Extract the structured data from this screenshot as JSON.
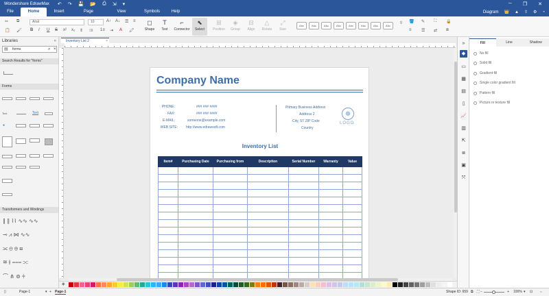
{
  "window": {
    "title": "Wondershare EdrawMax",
    "quick_access": [
      "↶",
      "↷",
      "💾",
      "📂",
      "⎙",
      "⇲",
      "▾"
    ],
    "controls": [
      "─",
      "❐",
      "✕"
    ]
  },
  "menu": {
    "tabs": [
      "File",
      "Home",
      "Insert",
      "Page Layout",
      "View",
      "Symbols",
      "Help"
    ],
    "active": "Home",
    "right_items": [
      "Diagram",
      "👑",
      "▲",
      "⇧",
      "⚙",
      "◔"
    ]
  },
  "ribbon": {
    "font_name": "Arial",
    "font_size": "10",
    "tools": {
      "shape": "Shape",
      "text": "Text",
      "connector": "Connector",
      "select": "Select",
      "position": "Position",
      "group": "Group",
      "align": "Align",
      "rotate": "Rotate",
      "size": "Size"
    },
    "style_boxes": [
      "Abc",
      "Abc",
      "Abc",
      "Abc",
      "Abc",
      "Abc",
      "Abc",
      "Abc"
    ]
  },
  "library": {
    "title": "Libraries",
    "search_value": "forms",
    "results_header": "Search Results for \"forms\"",
    "forms_header": "Forms",
    "transformers_header": "Transformers and Windings",
    "form_labels": [
      "Text",
      "Text",
      "Text"
    ]
  },
  "document": {
    "tab_name": "Inventory List 2",
    "company_name": "Company Name",
    "contact": {
      "phone_label": "PHONE:",
      "phone_value": "### ### ####",
      "fax_label": "FAX:",
      "fax_value": "### ### ####",
      "email_label": "E-MAIL:",
      "email_value": "someone@example.com",
      "web_label": "WEB SITE:",
      "web_value": "http://www.edrawsoft.com"
    },
    "address": {
      "line1": "Primary Business Address",
      "line2": "Address 2",
      "line3": "City, ST ZIP Code",
      "line4": "Country"
    },
    "logo_text": "LOGO",
    "list_title": "Inventory List",
    "table_headers": [
      "Item#",
      "Purchasing Date",
      "Purchasing from",
      "Description",
      "Serial Number",
      "Warranty",
      "Value"
    ],
    "empty_rows": 15
  },
  "palette_colors": [
    "#c00000",
    "#e53935",
    "#f06292",
    "#ec407a",
    "#d81b60",
    "#ff7043",
    "#ff8a65",
    "#ffa726",
    "#ffca28",
    "#ffeb3b",
    "#d4e157",
    "#9ccc65",
    "#66bb6a",
    "#26a69a",
    "#26c6da",
    "#29b6f6",
    "#42a5f5",
    "#1e88e5",
    "#3949ab",
    "#5e35b1",
    "#8e24aa",
    "#ab47bc",
    "#ba68c8",
    "#7e57c2",
    "#5c6bc0",
    "#3f51b5",
    "#1a237e",
    "#0d47a1",
    "#01579b",
    "#006064",
    "#004d40",
    "#1b5e20",
    "#33691e",
    "#827717",
    "#f57f17",
    "#ff6f00",
    "#e65100",
    "#bf360c",
    "#3e2723",
    "#795548",
    "#8d6e63",
    "#a1887f",
    "#bcaaa4",
    "#d7ccc8",
    "#ffe0b2",
    "#ffccbc",
    "#f8bbd0",
    "#e1bee7",
    "#d1c4e9",
    "#c5cae9",
    "#bbdefb",
    "#b3e5fc",
    "#b2ebf2",
    "#b2dfdb",
    "#c8e6c9",
    "#dcedc8",
    "#f0f4c3",
    "#fff9c4",
    "#ffecb3",
    "#000000",
    "#212121",
    "#424242",
    "#616161",
    "#757575",
    "#9e9e9e",
    "#bdbdbd",
    "#e0e0e0",
    "#eeeeee",
    "#f5f5f5",
    "#ffffff"
  ],
  "right_panel": {
    "tabs": [
      "Fill",
      "Line",
      "Shadow"
    ],
    "active_tab": "Fill",
    "options": [
      "No fill",
      "Solid fill",
      "Gradient fill",
      "Single color gradient fill",
      "Pattern fill",
      "Picture or texture fill"
    ]
  },
  "statusbar": {
    "page_selector": "Page-1",
    "page_tab": "Page-1",
    "shape_id": "Shape ID: 659",
    "zoom": "100%"
  }
}
